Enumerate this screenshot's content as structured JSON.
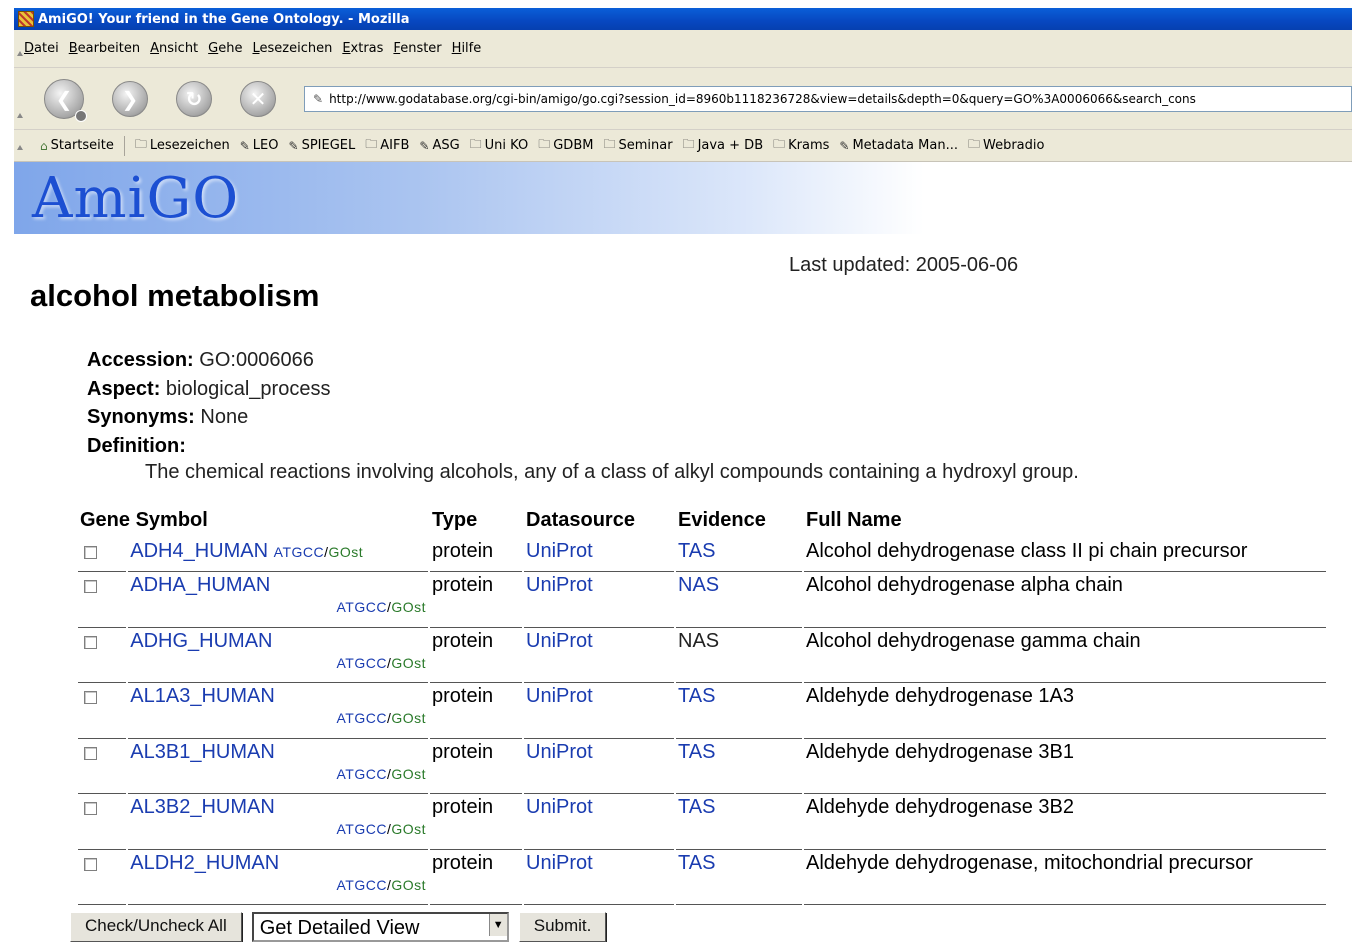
{
  "window": {
    "title": "AmiGO! Your friend in the Gene Ontology. - Mozilla"
  },
  "menu": [
    "Datei",
    "Bearbeiten",
    "Ansicht",
    "Gehe",
    "Lesezeichen",
    "Extras",
    "Fenster",
    "Hilfe"
  ],
  "url": "http://www.godatabase.org/cgi-bin/amigo/go.cgi?session_id=8960b1118236728&view=details&depth=0&query=GO%3A0006066&search_cons",
  "bookmarks": [
    {
      "label": "Startseite",
      "icon": "home-icon"
    },
    {
      "label": "Lesezeichen",
      "icon": "folder-icon"
    },
    {
      "label": "LEO",
      "icon": "bookmark-icon"
    },
    {
      "label": "SPIEGEL",
      "icon": "bookmark-icon"
    },
    {
      "label": "AIFB",
      "icon": "folder-icon"
    },
    {
      "label": "ASG",
      "icon": "bookmark-icon"
    },
    {
      "label": "Uni KO",
      "icon": "folder-icon"
    },
    {
      "label": "GDBM",
      "icon": "folder-icon"
    },
    {
      "label": "Seminar",
      "icon": "folder-icon"
    },
    {
      "label": "Java + DB",
      "icon": "folder-icon"
    },
    {
      "label": "Krams",
      "icon": "folder-icon"
    },
    {
      "label": "Metadata Man...",
      "icon": "bookmark-icon"
    },
    {
      "label": "Webradio",
      "icon": "folder-icon"
    }
  ],
  "banner": {
    "logo": "AmiGO"
  },
  "page": {
    "last_updated": "Last updated: 2005-06-06",
    "title": "alcohol metabolism",
    "accession_label": "Accession:",
    "accession": "GO:0006066",
    "aspect_label": "Aspect:",
    "aspect": "biological_process",
    "synonyms_label": "Synonyms:",
    "synonyms": "None",
    "definition_label": "Definition:",
    "definition": "The chemical reactions involving alcohols, any of a class of alkyl compounds containing a hydroxyl group."
  },
  "table": {
    "headers": [
      "Gene Symbol",
      "Type",
      "Datasource",
      "Evidence",
      "Full Name"
    ],
    "atgcc": "ATGCC",
    "slash": "/",
    "gost": "GOst",
    "rows": [
      {
        "symbol": "ADH4_HUMAN",
        "type": "protein",
        "source": "UniProt",
        "evidence": "TAS",
        "evidence_link": true,
        "name": "Alcohol dehydrogenase class II pi chain precursor"
      },
      {
        "symbol": "ADHA_HUMAN",
        "type": "protein",
        "source": "UniProt",
        "evidence": "NAS",
        "evidence_link": true,
        "name": "Alcohol dehydrogenase alpha chain"
      },
      {
        "symbol": "ADHG_HUMAN",
        "type": "protein",
        "source": "UniProt",
        "evidence": "NAS",
        "evidence_link": false,
        "name": "Alcohol dehydrogenase gamma chain"
      },
      {
        "symbol": "AL1A3_HUMAN",
        "type": "protein",
        "source": "UniProt",
        "evidence": "TAS",
        "evidence_link": true,
        "name": "Aldehyde dehydrogenase 1A3"
      },
      {
        "symbol": "AL3B1_HUMAN",
        "type": "protein",
        "source": "UniProt",
        "evidence": "TAS",
        "evidence_link": true,
        "name": "Aldehyde dehydrogenase 3B1"
      },
      {
        "symbol": "AL3B2_HUMAN",
        "type": "protein",
        "source": "UniProt",
        "evidence": "TAS",
        "evidence_link": true,
        "name": "Aldehyde dehydrogenase 3B2"
      },
      {
        "symbol": "ALDH2_HUMAN",
        "type": "protein",
        "source": "UniProt",
        "evidence": "TAS",
        "evidence_link": true,
        "name": "Aldehyde dehydrogenase, mitochondrial precursor"
      }
    ]
  },
  "form": {
    "check_all": "Check/Uncheck All",
    "view_select": "Get Detailed View",
    "submit": "Submit."
  },
  "colors": {
    "link": "#1a3cb0",
    "gost": "#2a7a2a",
    "logo": "#1c4fd2"
  }
}
